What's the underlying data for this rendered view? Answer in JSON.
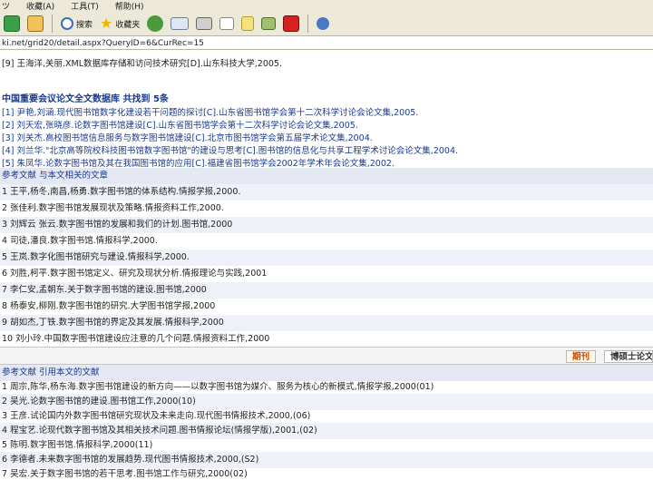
{
  "menu": [
    "ツ",
    "收藏(A)",
    "工具(T)",
    "帮助(H)"
  ],
  "toolbar": {
    "search_label": "搜索",
    "favorites_label": "收藏夹"
  },
  "address": "ki.net/grid20/detail.aspx?QueryID=6&CurRec=15",
  "references": [
    "[9] 王海洋,关丽.XML数据库存储和访问技术研究[D].山东科技大学,2005."
  ],
  "conference_section": {
    "title": "中国重要会议论文全文数据库  共找到 5条",
    "items": [
      "[1] 尹艳,刘涵.现代图书馆数字化建设若干问题的探讨[C].山东省图书馆学会第十二次科学讨论会论文集,2005.",
      "[2] 刘天宏,张晓彦.论数字图书馆建设[C].山东省图书馆学会第十二次科学讨论会论文集,2005.",
      "[3] 刘关杰.高校图书馆信息服务与数字图书馆建设[C].北京市图书馆学会第五届学术论文集,2004.",
      "[4] 刘兰华.\"北京高等院校科技图书馆数字图书馆\"的建设与思考[C].图书馆的信息化与共享工程学术讨论会论文集,2004.",
      "[5] 朱凤华.论数字图书馆及其在我国图书馆的应用[C].福建省图书馆学会2002年学术年会论文集,2002."
    ]
  },
  "recommended_section": {
    "title": "参考文献  与本文相关的文章",
    "items": [
      "1 王平,杨冬,南昌,杨勇.数字图书馆的体系结构.情报学报,2000.",
      "2 张佳利.数字图书馆发展现状及策略.情报资料工作,2000.",
      "3 刘辉云 张云.数字图书馆的发展和我们的计划.图书馆,2000",
      "4 司徒,潘良.数字图书馆.情报科学,2000.",
      "5 王岚.数字化图书馆研究与建设.情报科学,2000.",
      "6 刘胜,柯平.数字图书馆定义、研究及现状分析.情报理论与实践,2001",
      "7 李仁安,孟朝东.关于数字图书馆的建设.图书馆,2000",
      "8 杨泰安,柳刚.数字图书馆的研究.大学图书馆学报,2000",
      "9 胡如杰,丁铁.数字图书馆的界定及其发展.情报科学,2000",
      "10 刘小玲.中国数字图书馆建设应注意的几个问题.情报资料工作,2000"
    ]
  },
  "tabs": {
    "active": "期刊",
    "inactive": "博硕士论文"
  },
  "cited_section": {
    "title": "参考文献  引用本文的文献",
    "items": [
      "1 周宗,陈华,杨东海.数字图书馆建设的新方向——以数字图书馆为媒介、服务为核心的新模式,情报学报,2000(01)",
      "2 吴光.论数字图书馆的建设.图书馆工作,2000(10)",
      "3 王彦.试论国内外数字图书馆研究现状及未来走向.现代图书情报技术,2000,(06)",
      "4 程宝艺.论现代数字图书馆及其相关技术问题.图书情报论坛(情报学版),2001,(02)",
      "5 陈明.数字图书馆.情报科学,2000(11)",
      "6 李德者.未来数字图书馆的发展趋势.现代图书情报技术,2000,(S2)",
      "7 吴宏.关于数字图书馆的若干思考.图书馆工作与研究,2000(02)"
    ]
  }
}
